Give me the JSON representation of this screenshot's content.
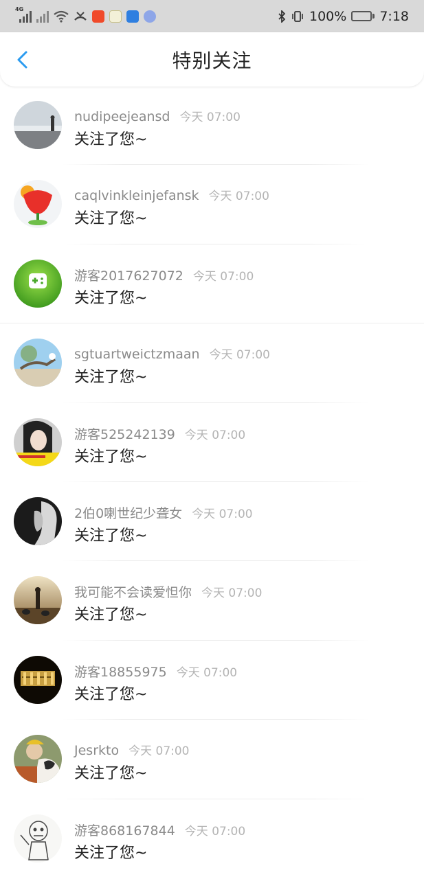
{
  "status_bar": {
    "network": "4G",
    "battery_text": "100%",
    "battery_level": 0.9,
    "time": "7:18",
    "icons": [
      "signal-icon",
      "signal-icon",
      "wifi-icon",
      "missed-call-icon",
      "ting-app-icon",
      "chat-app-icon",
      "blue-app-icon",
      "music-app-icon",
      "bluetooth-icon",
      "vibrate-icon",
      "battery-icon"
    ]
  },
  "header": {
    "title": "特别关注",
    "back_icon": "chevron-left-icon",
    "accent": "#2b9bf0"
  },
  "feed": [
    {
      "name": "nudipeejeansd",
      "time": "今天 07:00",
      "message": "关注了您~",
      "avatar": "beach-photo"
    },
    {
      "name": "caqlvinkleinjefansk",
      "time": "今天 07:00",
      "message": "关注了您~",
      "avatar": "flower-photo"
    },
    {
      "name": "游客2017627072",
      "time": "今天 07:00",
      "message": "关注了您~",
      "avatar": "game-icon"
    },
    {
      "name": "sgtuartweictzmaan",
      "time": "今天 07:00",
      "message": "关注了您~",
      "avatar": "tree-photo"
    },
    {
      "name": "游客525242139",
      "time": "今天 07:00",
      "message": "关注了您~",
      "avatar": "girl-photo"
    },
    {
      "name": "2伯0喇世纪少聋女",
      "time": "今天 07:00",
      "message": "关注了您~",
      "avatar": "portrait-photo"
    },
    {
      "name": "我可能不会读爱怛你",
      "time": "今天 07:00",
      "message": "关注了您~",
      "avatar": "sunset-dogs-photo"
    },
    {
      "name": "游客18855975",
      "time": "今天 07:00",
      "message": "关注了您~",
      "avatar": "night-building-photo"
    },
    {
      "name": "Jesrkto",
      "time": "今天 07:00",
      "message": "关注了您~",
      "avatar": "dog-photo"
    },
    {
      "name": "游客868167844",
      "time": "今天 07:00",
      "message": "关注了您~",
      "avatar": "cartoon-sketch"
    }
  ]
}
